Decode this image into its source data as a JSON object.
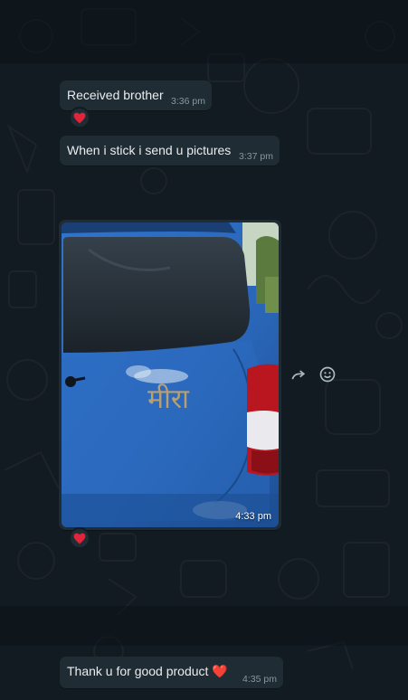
{
  "messages": [
    {
      "text": "Received brother",
      "time": "3:36 pm",
      "reaction": "heart"
    },
    {
      "text": "When i stick i send u pictures",
      "time": "3:37 pm"
    },
    {
      "type": "image",
      "alt": "Photo of blue car with gold sticker",
      "time": "4:33 pm",
      "reaction": "heart"
    },
    {
      "text": "Thank u for good product ❤️",
      "time": "4:35 pm"
    }
  ],
  "hover_actions": {
    "forward_icon": "forward-icon",
    "react_icon": "emoji-icon"
  },
  "colors": {
    "background": "#111b21",
    "bubble": "#202c33",
    "text": "#e9edef",
    "timestamp": "#8696a0",
    "heart": "#e0243a",
    "car": "#2d6fc4"
  }
}
